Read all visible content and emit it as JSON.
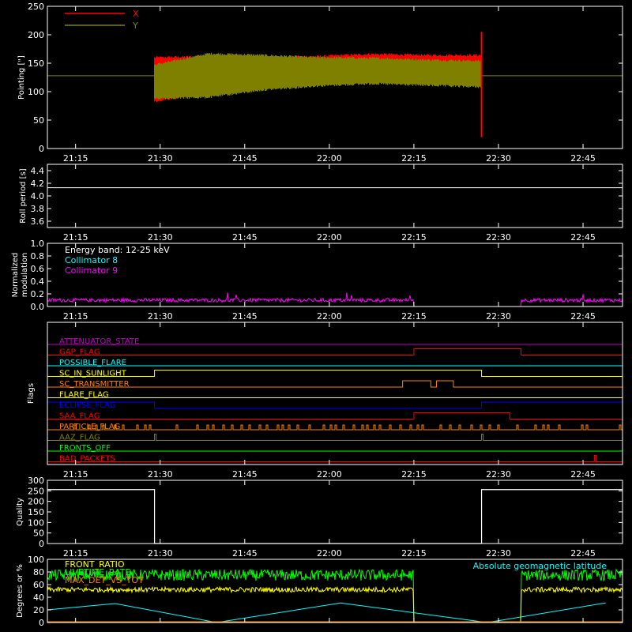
{
  "time_ticks": [
    "21:15",
    "21:30",
    "21:45",
    "22:00",
    "22:15",
    "22:30",
    "22:45"
  ],
  "colors": {
    "x": "#ff0000",
    "y": "#808000",
    "cyan": "#00ffff",
    "magenta": "#ff00ff",
    "yellow": "#ffff00",
    "green": "#00ff00",
    "orange": "#ff8000",
    "blue": "#0000ff",
    "red": "#ff0000",
    "purple": "#c000c0",
    "white": "#ffffff",
    "olive": "#808000"
  },
  "chart_data": [
    {
      "type": "line",
      "ylabel": "Pointing [\"]",
      "ylim": [
        0,
        250
      ],
      "yticks": [
        "0",
        "50",
        "100",
        "150",
        "200",
        "250"
      ],
      "x_range": [
        "21:10",
        "22:52"
      ],
      "series": [
        {
          "name": "X",
          "color": "#ff0000",
          "band_start": "21:29",
          "band_end": "22:27",
          "band_values": [
            [
              85,
              158
            ],
            [
              100,
              160
            ],
            [
              110,
              158
            ],
            [
              118,
              160
            ],
            [
              122,
              164
            ],
            [
              125,
              162
            ],
            [
              122,
              162
            ]
          ],
          "outside_value": 128,
          "spike_at": "22:27",
          "spike_range": [
            20,
            205
          ]
        },
        {
          "name": "Y",
          "color": "#808000",
          "band_start": "21:29",
          "band_end": "22:27",
          "band_values": [
            [
              90,
              145
            ],
            [
              92,
              165
            ],
            [
              105,
              162
            ],
            [
              112,
              158
            ],
            [
              116,
              157
            ],
            [
              113,
              154
            ],
            [
              110,
              152
            ]
          ],
          "outside_value": 128
        }
      ]
    },
    {
      "type": "line",
      "ylabel": "Roll period [s]",
      "ylim": [
        3.5,
        4.5
      ],
      "yticks": [
        "3.6",
        "3.8",
        "4.0",
        "4.2",
        "4.4"
      ],
      "series": [
        {
          "name": "",
          "color": "#ffffff",
          "value": 4.13
        }
      ]
    },
    {
      "type": "line",
      "ylabel": "Normalized modulation",
      "ylim": [
        0,
        1
      ],
      "yticks": [
        "0.0",
        "0.2",
        "0.4",
        "0.6",
        "0.8",
        "1.0"
      ],
      "annotations": [
        "Energy band: 12-25 keV"
      ],
      "series": [
        {
          "name": "Collimator 8",
          "color": "#00ffff"
        },
        {
          "name": "Collimator 9",
          "color": "#ff00ff",
          "base_value": 0.1,
          "gap": [
            "22:15",
            "22:34"
          ]
        }
      ]
    },
    {
      "type": "line",
      "ylabel": "Flags",
      "flags": [
        {
          "name": "ATTENUATOR_STATE",
          "color": "#c000c0",
          "high": []
        },
        {
          "name": "GAP_FLAG",
          "color": "#ff0000",
          "high": [
            [
              "22:15",
              "22:34"
            ]
          ]
        },
        {
          "name": "POSSIBLE_FLARE",
          "color": "#00ffff",
          "high": []
        },
        {
          "name": "SC_IN_SUNLIGHT",
          "color": "#ffff00",
          "high": [
            [
              "21:29",
              "22:27"
            ]
          ]
        },
        {
          "name": "SC_TRANSMITTER",
          "color": "#ff8000",
          "high": [
            [
              "22:13",
              "22:18"
            ],
            [
              "22:19",
              "22:22"
            ]
          ]
        },
        {
          "name": "FLARE_FLAG",
          "color": "#ffff00",
          "high": []
        },
        {
          "name": "ECLIPSE_FLAG",
          "color": "#0000ff",
          "high": [
            [
              "21:10",
              "21:29"
            ],
            [
              "22:27",
              "22:52"
            ]
          ]
        },
        {
          "name": "SAA_FLAG",
          "color": "#ff0000",
          "high": [
            [
              "22:15",
              "22:32"
            ]
          ]
        },
        {
          "name": "PARTICLE_FLAG",
          "color": "#ff8000",
          "high": "intermittent"
        },
        {
          "name": "AAZ_FLAG",
          "color": "#808000",
          "high": [
            [
              "21:29",
              "21:29"
            ],
            [
              "22:27",
              "22:27"
            ]
          ]
        },
        {
          "name": "FRONTS_OFF",
          "color": "#00ff00",
          "high": []
        },
        {
          "name": "BAD_PACKETS",
          "color": "#ff0000",
          "high": [
            [
              "22:47",
              "22:47"
            ]
          ]
        }
      ]
    },
    {
      "type": "line",
      "ylabel": "Quality",
      "ylim": [
        0,
        300
      ],
      "yticks": [
        "0",
        "50",
        "100",
        "150",
        "200",
        "250",
        "300"
      ],
      "series": [
        {
          "name": "",
          "color": "#ffffff",
          "segments": [
            [
              "21:10",
              "21:29",
              256
            ],
            [
              "21:29",
              "22:27",
              0
            ],
            [
              "22:27",
              "22:52",
              256
            ]
          ]
        }
      ]
    },
    {
      "type": "line",
      "ylabel": "Degrees or %",
      "ylim": [
        0,
        100
      ],
      "yticks": [
        "0",
        "20",
        "40",
        "60",
        "80",
        "100"
      ],
      "series": [
        {
          "name": "FRONT_RATIO",
          "color": "#ffff00",
          "base_value": 52,
          "gap": [
            "22:15",
            "22:34"
          ]
        },
        {
          "name": "LIVETIME_RATE",
          "color": "#00ff00",
          "base_value": 75,
          "gap": [
            "22:15",
            "22:34"
          ]
        },
        {
          "name": "MAX_DET_VS_TOT",
          "color": "#ff8000",
          "base_value": 0
        },
        {
          "name": "Absolute geomagnetic latitude",
          "color": "#00ffff",
          "peaks": [
            [
              "21:10",
              20
            ],
            [
              "21:22",
              30
            ],
            [
              "21:40",
              0
            ],
            [
              "22:02",
              31
            ],
            [
              "22:28",
              0
            ],
            [
              "22:49",
              31
            ]
          ]
        }
      ]
    }
  ]
}
